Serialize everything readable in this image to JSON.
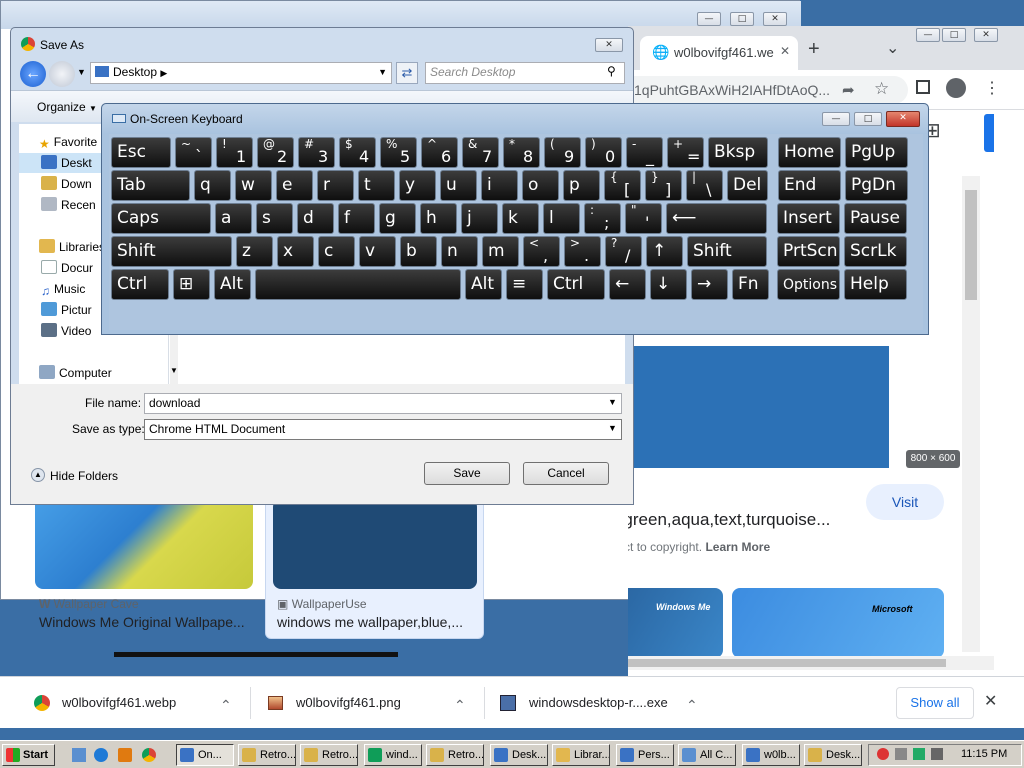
{
  "explorer_bg": {
    "buttons": [
      "—",
      "□",
      "✕"
    ]
  },
  "chrome": {
    "tab_title": "w0lbovifgf461.we",
    "tab_close": "✕",
    "new_tab": "+",
    "tab_search": "⌄",
    "win_buttons": [
      "—",
      "□",
      "✕"
    ],
    "url_fragment": "1qPuhtGBAxWiH2IAHfDtAoQ...",
    "image_size_badge": "800 × 600",
    "visit_label": "Visit",
    "result_title": "wallpaper,blue,green,aqua,text,turquoise...",
    "copyright_note": "Images may be subject to copyright.",
    "learn_more": "Learn More",
    "thumbs": [
      {
        "source": "Wallpaper Cave",
        "title": "Windows Me Original Wallpape..."
      },
      {
        "source": "WallpaperUse",
        "title": "windows me wallpaper,blue,..."
      }
    ],
    "related_text": [
      "Windows Me",
      "Microsoft"
    ]
  },
  "saveas": {
    "title": "Save As",
    "close": "✕",
    "location": "Desktop",
    "search_placeholder": "Search Desktop",
    "organize": "Organize",
    "nav": [
      "Favorite",
      "Deskt",
      "Down",
      "Recen",
      "Libraries",
      "Docur",
      "Music",
      "Pictur",
      "Video",
      "Computer"
    ],
    "filename_label": "File name:",
    "filename_value": "download",
    "type_label": "Save as type:",
    "type_value": "Chrome HTML Document",
    "hide_folders": "Hide Folders",
    "save": "Save",
    "cancel": "Cancel"
  },
  "osk": {
    "title": "On-Screen Keyboard",
    "win_buttons": [
      "—",
      "□",
      "✕"
    ],
    "rows": [
      [
        {
          "l": "Esc",
          "w": 61
        },
        {
          "t": "~",
          "b": "`",
          "w": 38
        },
        {
          "t": "!",
          "b": "1",
          "w": 38
        },
        {
          "t": "@",
          "b": "2",
          "w": 38
        },
        {
          "t": "#",
          "b": "3",
          "w": 38
        },
        {
          "t": "$",
          "b": "4",
          "w": 38
        },
        {
          "t": "%",
          "b": "5",
          "w": 38
        },
        {
          "t": "^",
          "b": "6",
          "w": 38
        },
        {
          "t": "&",
          "b": "7",
          "w": 38
        },
        {
          "t": "*",
          "b": "8",
          "w": 38
        },
        {
          "t": "(",
          "b": "9",
          "w": 38
        },
        {
          "t": ")",
          "b": "0",
          "w": 38
        },
        {
          "t": "-",
          "b": "_",
          "w": 38
        },
        {
          "t": "+",
          "b": "=",
          "w": 38
        },
        {
          "l": "Bksp",
          "w": 61
        },
        {
          "gap": 6
        },
        {
          "l": "Home",
          "w": 64
        },
        {
          "l": "PgUp",
          "w": 64
        }
      ],
      [
        {
          "l": "Tab",
          "w": 80
        },
        {
          "l": "q",
          "w": 38
        },
        {
          "l": "w",
          "w": 38
        },
        {
          "l": "e",
          "w": 38
        },
        {
          "l": "r",
          "w": 38
        },
        {
          "l": "t",
          "w": 38
        },
        {
          "l": "y",
          "w": 38
        },
        {
          "l": "u",
          "w": 38
        },
        {
          "l": "i",
          "w": 38
        },
        {
          "l": "o",
          "w": 38
        },
        {
          "l": "p",
          "w": 38
        },
        {
          "t": "{",
          "b": "[",
          "w": 38
        },
        {
          "t": "}",
          "b": "]",
          "w": 38
        },
        {
          "t": "|",
          "b": "\\",
          "w": 38
        },
        {
          "l": "Del",
          "w": 42
        },
        {
          "gap": 6
        },
        {
          "l": "End",
          "w": 64
        },
        {
          "l": "PgDn",
          "w": 64
        }
      ],
      [
        {
          "l": "Caps",
          "w": 101
        },
        {
          "l": "a",
          "w": 38
        },
        {
          "l": "s",
          "w": 38
        },
        {
          "l": "d",
          "w": 38
        },
        {
          "l": "f",
          "w": 38
        },
        {
          "l": "g",
          "w": 38
        },
        {
          "l": "h",
          "w": 38
        },
        {
          "l": "j",
          "w": 38
        },
        {
          "l": "k",
          "w": 38
        },
        {
          "l": "l",
          "w": 38
        },
        {
          "t": ":",
          "b": ";",
          "w": 38
        },
        {
          "t": "\"",
          "b": "'",
          "w": 38
        },
        {
          "l": "⟵",
          "w": 102
        },
        {
          "gap": 6
        },
        {
          "l": "Insert",
          "w": 64
        },
        {
          "l": "Pause",
          "w": 64
        }
      ],
      [
        {
          "l": "Shift",
          "w": 122
        },
        {
          "l": "z",
          "w": 38
        },
        {
          "l": "x",
          "w": 38
        },
        {
          "l": "c",
          "w": 38
        },
        {
          "l": "v",
          "w": 38
        },
        {
          "l": "b",
          "w": 38
        },
        {
          "l": "n",
          "w": 38
        },
        {
          "l": "m",
          "w": 38
        },
        {
          "t": "<",
          "b": ",",
          "w": 38
        },
        {
          "t": ">",
          "b": ".",
          "w": 38
        },
        {
          "t": "?",
          "b": "/",
          "w": 38
        },
        {
          "l": "↑",
          "w": 38
        },
        {
          "l": "Shift",
          "w": 81
        },
        {
          "gap": 6
        },
        {
          "l": "PrtScn",
          "w": 64
        },
        {
          "l": "ScrLk",
          "w": 64
        }
      ],
      [
        {
          "l": "Ctrl",
          "w": 59
        },
        {
          "l": "⊞",
          "w": 38
        },
        {
          "l": "Alt",
          "w": 38
        },
        {
          "l": "",
          "w": 207
        },
        {
          "l": "Alt",
          "w": 38
        },
        {
          "l": "≡",
          "w": 38
        },
        {
          "l": "Ctrl",
          "w": 59
        },
        {
          "l": "←",
          "w": 38
        },
        {
          "l": "↓",
          "w": 38
        },
        {
          "l": "→",
          "w": 38
        },
        {
          "l": "Fn",
          "w": 38
        },
        {
          "gap": 4
        },
        {
          "l": "Options",
          "w": 64,
          "small": true
        },
        {
          "l": "Help",
          "w": 64
        }
      ]
    ]
  },
  "downloads": {
    "items": [
      {
        "name": "w0lbovifgf461.webp",
        "icon": "chrome-icon"
      },
      {
        "name": "w0lbovifgf461.png",
        "icon": "image-icon"
      },
      {
        "name": "windowsdesktop-r....exe",
        "icon": "installer-icon"
      }
    ],
    "chevron": "⌃",
    "show_all": "Show all",
    "close": "✕"
  },
  "taskbar": {
    "start": "Start",
    "buttons": [
      "On...",
      "Retro...",
      "Retro...",
      "wind...",
      "Retro...",
      "Desk...",
      "Librar...",
      "Pers...",
      "All C...",
      "w0lb...",
      "Desk..."
    ],
    "time": "11:15 PM"
  }
}
